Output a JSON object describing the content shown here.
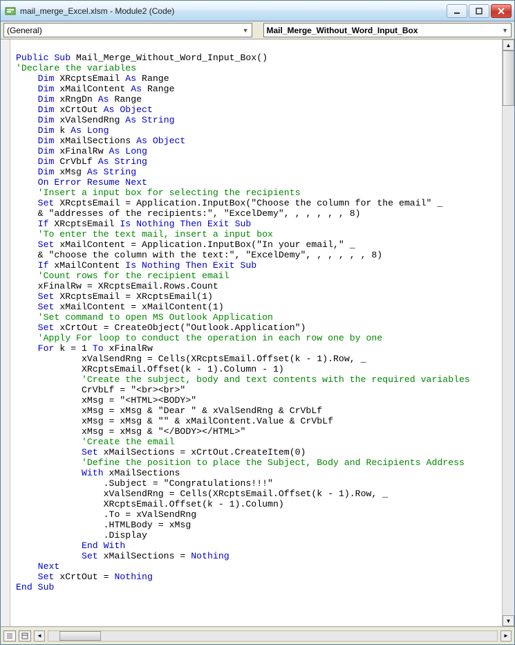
{
  "window": {
    "title": "mail_merge_Excel.xlsm - Module2 (Code)"
  },
  "dropdowns": {
    "left": "(General)",
    "right": "Mail_Merge_Without_Word_Input_Box"
  },
  "code": {
    "l01a": "Public Sub",
    "l01b": " Mail_Merge_Without_Word_Input_Box()",
    "l02": "'Declare the variables",
    "l03a": "Dim",
    "l03b": " XRcptsEmail ",
    "l03c": "As",
    "l03d": " Range",
    "l04a": "Dim",
    "l04b": " xMailContent ",
    "l04c": "As",
    "l04d": " Range",
    "l05a": "Dim",
    "l05b": " xRngDn ",
    "l05c": "As",
    "l05d": " Range",
    "l06a": "Dim",
    "l06b": " xCrtOut ",
    "l06c": "As Object",
    "l07a": "Dim",
    "l07b": " xValSendRng ",
    "l07c": "As String",
    "l08a": "Dim",
    "l08b": " k ",
    "l08c": "As Long",
    "l09a": "Dim",
    "l09b": " xMailSections ",
    "l09c": "As Object",
    "l10a": "Dim",
    "l10b": " xFinalRw ",
    "l10c": "As Long",
    "l11a": "Dim",
    "l11b": " CrVbLf ",
    "l11c": "As String",
    "l12a": "Dim",
    "l12b": " xMsg ",
    "l12c": "As String",
    "l13": "On Error Resume Next",
    "l14": "'Insert a input box for selecting the recipients",
    "l15a": "Set",
    "l15b": " XRcptsEmail = Application.InputBox(\"Choose the column for the email\" _",
    "l16": "& \"addresses of the recipients:\", \"ExcelDemy\", , , , , , 8)",
    "l17a": "If",
    "l17b": " XRcptsEmail ",
    "l17c": "Is Nothing Then Exit Sub",
    "l18": "'To enter the text mail, insert a input box",
    "l19a": "Set",
    "l19b": " xMailContent = Application.InputBox(\"In your email,\" _",
    "l20": "& \"choose the column with the text:\", \"ExcelDemy\", , , , , , 8)",
    "l21a": "If",
    "l21b": " xMailContent ",
    "l21c": "Is Nothing Then Exit Sub",
    "l22": "'Count rows for the recipient email",
    "l23": "xFinalRw = XRcptsEmail.Rows.Count",
    "l24a": "Set",
    "l24b": " XRcptsEmail = XRcptsEmail(1)",
    "l25a": "Set",
    "l25b": " xMailContent = xMailContent(1)",
    "l26": "'Set command to open MS Outlook Application",
    "l27a": "Set",
    "l27b": " xCrtOut = CreateObject(\"Outlook.Application\")",
    "l28": "'Apply For loop to conduct the operation in each row one by one",
    "l29a": "For",
    "l29b": " k = 1 ",
    "l29c": "To",
    "l29d": " xFinalRw",
    "l30": "xValSendRng = Cells(XRcptsEmail.Offset(k - 1).Row, _",
    "l31": "XRcptsEmail.Offset(k - 1).Column - 1)",
    "l32": "'Create the subject, body and text contents with the required variables",
    "l33": "CrVbLf = \"<br><br>\"",
    "l34": "xMsg = \"<HTML><BODY>\"",
    "l35": "xMsg = xMsg & \"Dear \" & xValSendRng & CrVbLf",
    "l36": "xMsg = xMsg & \"\" & xMailContent.Value & CrVbLf",
    "l37": "xMsg = xMsg & \"</BODY></HTML>\"",
    "l38": "'Create the email",
    "l39a": "Set",
    "l39b": " xMailSections = xCrtOut.CreateItem(0)",
    "l40": "'Define the position to place the Subject, Body and Recipients Address",
    "l41a": "With",
    "l41b": " xMailSections",
    "l42": ".Subject = \"Congratulations!!!\"",
    "l43": "xValSendRng = Cells(XRcptsEmail.Offset(k - 1).Row, _",
    "l44": "XRcptsEmail.Offset(k - 1).Column)",
    "l45": ".To = xValSendRng",
    "l46": ".HTMLBody = xMsg",
    "l47": ".Display",
    "l48": "End With",
    "l49a": "Set",
    "l49b": " xMailSections = ",
    "l49c": "Nothing",
    "l50": "Next",
    "l51a": "Set",
    "l51b": " xCrtOut = ",
    "l51c": "Nothing",
    "l52": "End Sub"
  }
}
